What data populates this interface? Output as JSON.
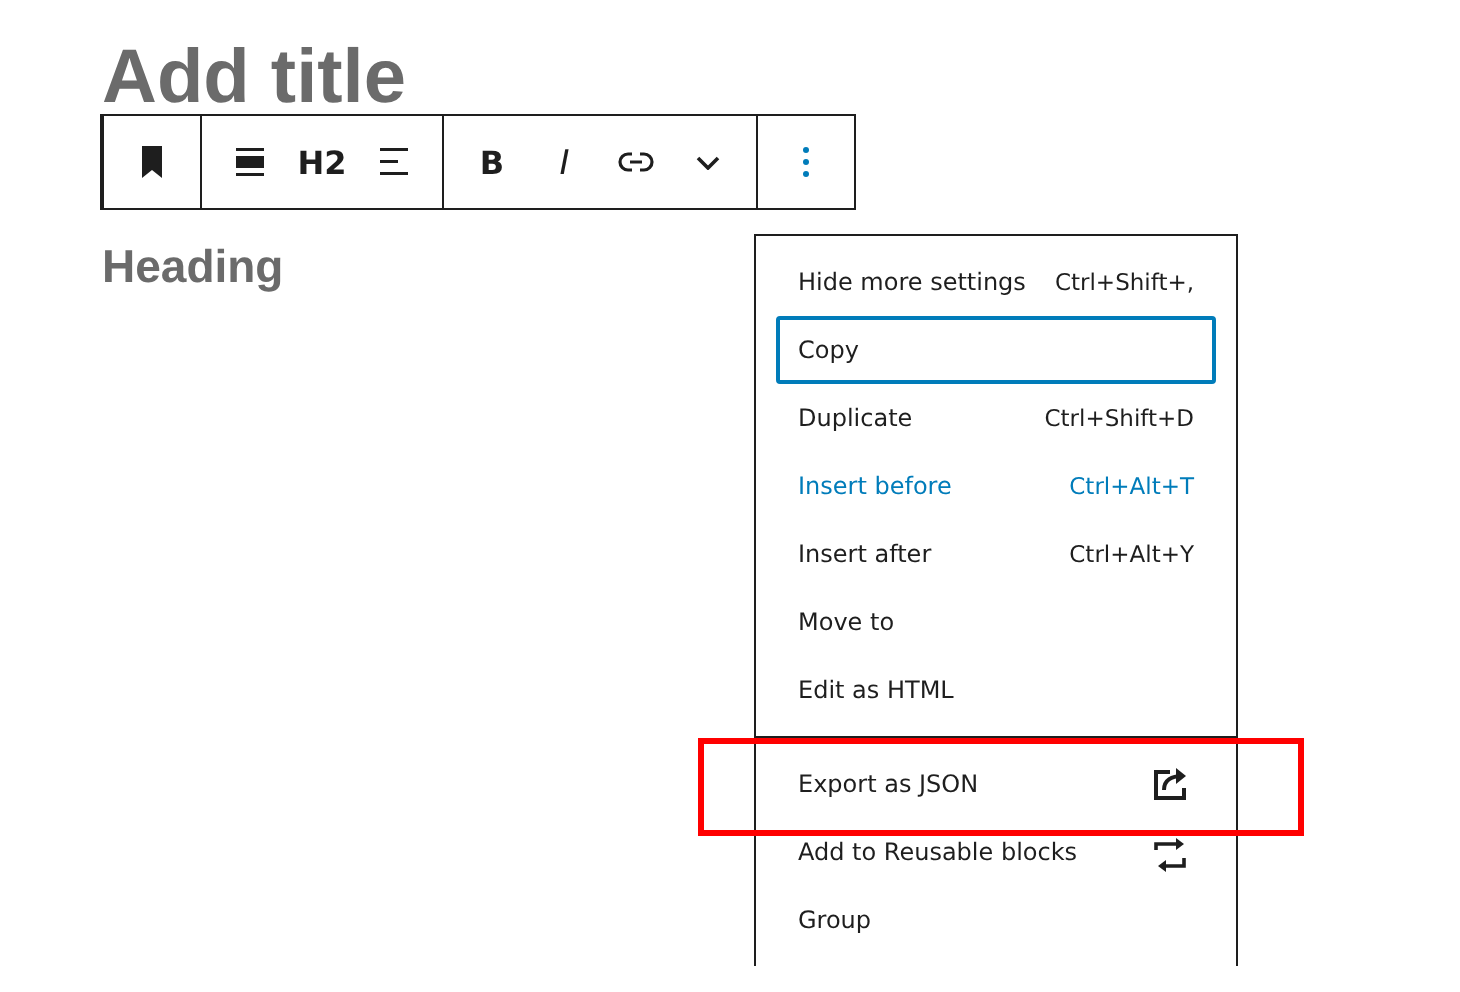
{
  "editor": {
    "title": "Add title",
    "heading": "Heading"
  },
  "toolbar": {
    "groups": [
      {
        "buttons": [
          {
            "kind": "bookmark",
            "selected": false
          }
        ]
      },
      {
        "buttons": [
          {
            "kind": "align",
            "selected": false
          },
          {
            "kind": "text",
            "label": "H2",
            "selected": false
          },
          {
            "kind": "lines",
            "selected": false
          }
        ]
      },
      {
        "buttons": [
          {
            "kind": "text",
            "label": "B",
            "selected": false
          },
          {
            "kind": "italic",
            "label": "I",
            "selected": false
          },
          {
            "kind": "link",
            "selected": false
          },
          {
            "kind": "chevron",
            "selected": false
          }
        ]
      },
      {
        "buttons": [
          {
            "kind": "dots",
            "selected": true
          }
        ]
      }
    ]
  },
  "menu": {
    "sections": [
      {
        "items": [
          {
            "label": "Hide more settings",
            "shortcut": "Ctrl+Shift+,",
            "kind": "shortcut",
            "focused": false,
            "hovered": false,
            "annotated": false
          },
          {
            "label": "Copy",
            "kind": "plain",
            "focused": true,
            "hovered": false,
            "annotated": false
          },
          {
            "label": "Duplicate",
            "shortcut": "Ctrl+Shift+D",
            "kind": "shortcut",
            "focused": false,
            "hovered": false,
            "annotated": false
          },
          {
            "label": "Insert before",
            "shortcut": "Ctrl+Alt+T",
            "kind": "shortcut",
            "focused": false,
            "hovered": true,
            "annotated": false
          },
          {
            "label": "Insert after",
            "shortcut": "Ctrl+Alt+Y",
            "kind": "shortcut",
            "focused": false,
            "hovered": false,
            "annotated": false
          },
          {
            "label": "Move to",
            "kind": "plain",
            "focused": false,
            "hovered": false,
            "annotated": false
          },
          {
            "label": "Edit as HTML",
            "kind": "plain",
            "focused": false,
            "hovered": false,
            "annotated": false
          }
        ]
      },
      {
        "items": [
          {
            "label": "Export as JSON",
            "kind": "export",
            "focused": false,
            "hovered": false,
            "annotated": true
          },
          {
            "label": "Add to Reusable blocks",
            "kind": "reusable",
            "focused": false,
            "hovered": false,
            "annotated": false
          },
          {
            "label": "Group",
            "kind": "plain",
            "focused": false,
            "hovered": false,
            "annotated": false
          }
        ]
      }
    ]
  }
}
